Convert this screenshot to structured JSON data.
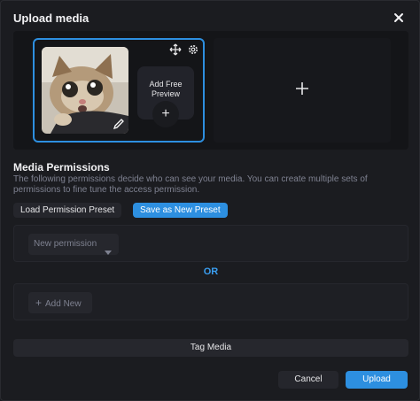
{
  "dialog": {
    "title": "Upload media"
  },
  "media": {
    "thumbnail_alt": "Cat photo",
    "free_preview_label_line1": "Add Free",
    "free_preview_label_line2": "Preview",
    "free_preview_plus": "+",
    "add_media_plus": "+"
  },
  "permissions": {
    "title": "Media Permissions",
    "description": "The following permissions decide who can see your media. You can create multiple sets of permissions to fine tune the access permission.",
    "load_preset_label": "Load Permission Preset",
    "save_preset_label": "Save as New Preset",
    "new_permission_placeholder": "New permission",
    "or_label": "OR",
    "add_new_label": "Add New",
    "add_new_plus": "+"
  },
  "actions": {
    "tag_media_label": "Tag Media",
    "cancel_label": "Cancel",
    "upload_label": "Upload"
  },
  "colors": {
    "accent": "#2d8fe0",
    "background": "#1b1c20",
    "muted_text": "#7e8190"
  },
  "icons": {
    "close": "close-icon",
    "move": "move-icon",
    "settings": "gear-icon",
    "edit": "pencil-icon",
    "dropdown": "chevron-down-icon"
  }
}
